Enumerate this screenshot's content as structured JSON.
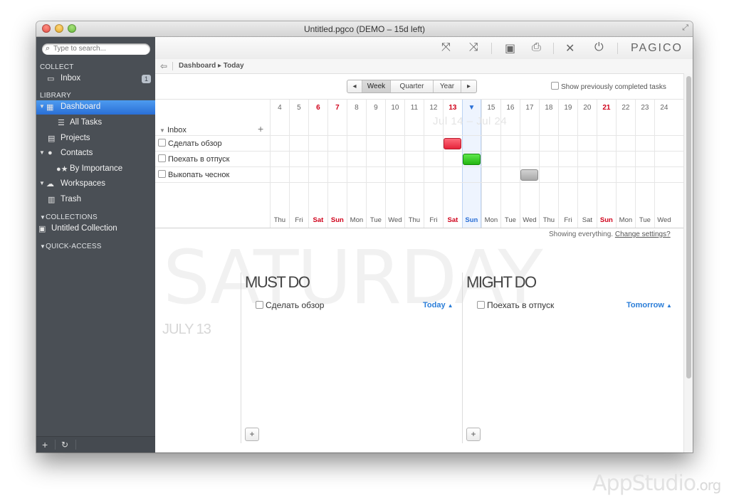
{
  "window": {
    "title": "Untitled.pgco (DEMO – 15d left)"
  },
  "sidebar": {
    "search_placeholder": "Type to search...",
    "collect_header": "COLLECT",
    "inbox": {
      "label": "Inbox",
      "badge": "1"
    },
    "library_header": "LIBRARY",
    "items": [
      {
        "label": "Dashboard"
      },
      {
        "label": "All Tasks"
      },
      {
        "label": "Projects"
      },
      {
        "label": "Contacts"
      },
      {
        "label": "By Importance"
      },
      {
        "label": "Workspaces"
      },
      {
        "label": "Trash"
      }
    ],
    "collections_header": "COLLECTIONS",
    "collection_item": "Untitled Collection",
    "quick_access_header": "QUICK-ACCESS"
  },
  "toolbar": {
    "logo": "PAGICO"
  },
  "breadcrumb": {
    "path": "Dashboard ▸ Today"
  },
  "range": {
    "prev": "◂",
    "week": "Week",
    "quarter": "Quarter",
    "year": "Year",
    "next": "▸",
    "selected": "Week"
  },
  "show_completed_label": "Show previously completed tasks",
  "calendar": {
    "day_numbers": [
      "4",
      "5",
      "6",
      "7",
      "8",
      "9",
      "10",
      "11",
      "12",
      "13",
      "14",
      "15",
      "16",
      "17",
      "18",
      "19",
      "20",
      "21",
      "22",
      "23",
      "24"
    ],
    "day_names": [
      "Thu",
      "Fri",
      "Sat",
      "Sun",
      "Mon",
      "Tue",
      "Wed",
      "Thu",
      "Fri",
      "Sat",
      "Sun",
      "Mon",
      "Tue",
      "Wed",
      "Thu",
      "Fri",
      "Sat",
      "Sun",
      "Mon",
      "Tue",
      "Wed"
    ],
    "weekend_indices": [
      2,
      3,
      9,
      17
    ],
    "today_index": 10,
    "range_label": "Jul 14 – Jul 24",
    "inbox_label": "Inbox",
    "tasks": [
      {
        "name": "Сделать обзор",
        "day_index": 9,
        "color": "#e5243b"
      },
      {
        "name": "Поехать в отпуск",
        "day_index": 10,
        "color": "#23b512"
      },
      {
        "name": "Выкопать чеснок",
        "day_index": 13,
        "color": "#a8a8a8"
      }
    ]
  },
  "showing": {
    "text": "Showing everything.",
    "link": "Change settings?"
  },
  "day_view": {
    "weekday": "SATURDAY",
    "date": "JULY 13",
    "must_do": {
      "title": "MUST DO",
      "task": "Сделать обзор",
      "when": "Today"
    },
    "might_do": {
      "title": "MIGHT DO",
      "task": "Поехать в отпуск",
      "when": "Tomorrow"
    }
  },
  "watermark": {
    "name": "AppStudio",
    "suffix": ".org"
  },
  "colors": {
    "accent": "#2a6fd6",
    "weekend": "#d0021b",
    "sidebar_bg": "#4a4f55",
    "link_blue": "#2a7dd8"
  }
}
